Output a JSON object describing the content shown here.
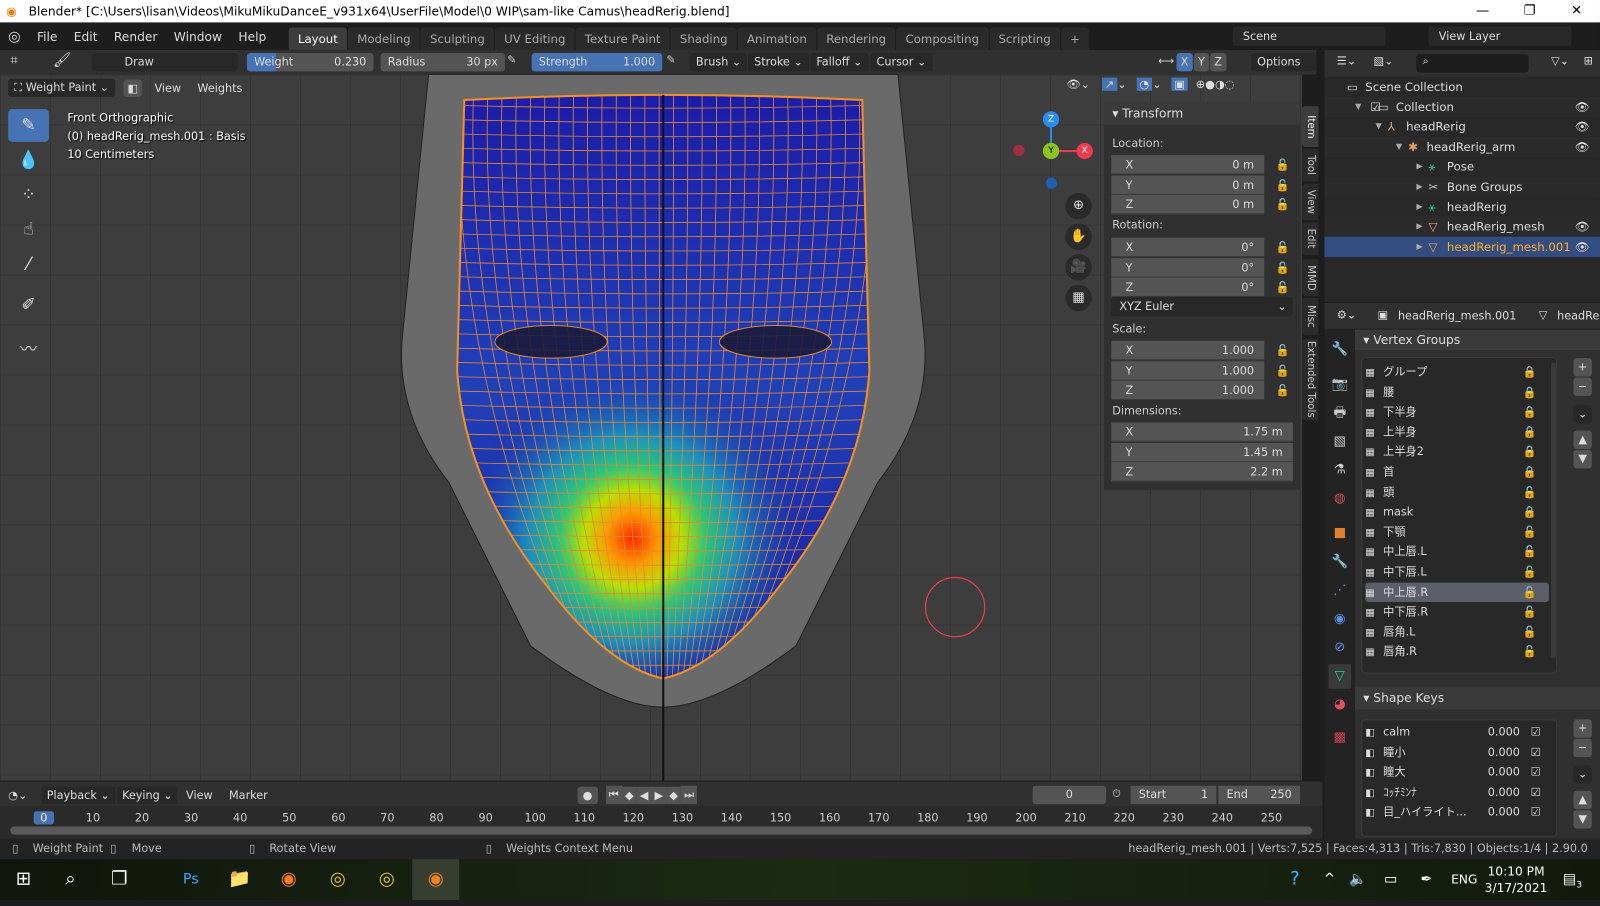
{
  "window": {
    "title": "Blender* [C:\\Users\\lisan\\Videos\\MikuMikuDanceE_v931x64\\UserFile\\Model\\0 WIP\\sam-like Camus\\headRerig.blend]",
    "minimize": "—",
    "maximize": "❐",
    "close": "✕"
  },
  "menu": [
    "File",
    "Edit",
    "Render",
    "Window",
    "Help"
  ],
  "workspaces": [
    "Layout",
    "Modeling",
    "Sculpting",
    "UV Editing",
    "Texture Paint",
    "Shading",
    "Animation",
    "Rendering",
    "Compositing",
    "Scripting",
    "+"
  ],
  "scene": {
    "name": "Scene",
    "view_layer": "View Layer"
  },
  "toolheader": {
    "brush": "Draw",
    "weight_label": "Weight",
    "weight": "0.230",
    "weight_value": 0.23,
    "radius_label": "Radius",
    "radius": "30 px",
    "strength_label": "Strength",
    "strength": "1.000",
    "strength_value": 1.0,
    "menus": [
      "Brush",
      "Stroke",
      "Falloff",
      "Cursor"
    ],
    "mirror": [
      "X",
      "Y",
      "Z"
    ],
    "options": "Options"
  },
  "viewport": {
    "mode": "Weight Paint",
    "menus": [
      "View",
      "Weights"
    ],
    "info": [
      "Front Orthographic",
      "(0) headRerig_mesh.001 : Basis",
      "10 Centimeters"
    ],
    "gizmo": {
      "z": "Z",
      "y": "Y",
      "x": "X"
    }
  },
  "npanel": {
    "title": "Transform",
    "location_label": "Location:",
    "rotation_label": "Rotation:",
    "scale_label": "Scale:",
    "dimensions_label": "Dimensions:",
    "axes": [
      "X",
      "Y",
      "Z"
    ],
    "location": [
      "0 m",
      "0 m",
      "0 m"
    ],
    "rotation": [
      "0°",
      "0°",
      "0°"
    ],
    "rotation_mode": "XYZ Euler",
    "scale": [
      "1.000",
      "1.000",
      "1.000"
    ],
    "dimensions": [
      "1.75 m",
      "1.45 m",
      "2.2 m"
    ],
    "tabs": [
      "Item",
      "Tool",
      "View",
      "Edit",
      "MMD",
      "Misc",
      "Extended Tools"
    ]
  },
  "outliner": {
    "items": [
      {
        "label": "Scene Collection",
        "icon": "collection-icon"
      },
      {
        "label": "Collection",
        "icon": "collection-icon"
      },
      {
        "label": "headRerig",
        "icon": "armature-icon"
      },
      {
        "label": "headRerig_arm",
        "icon": "armature-data-icon"
      },
      {
        "label": "Pose",
        "icon": "pose-icon"
      },
      {
        "label": "Bone Groups",
        "icon": "bone-icon"
      },
      {
        "label": "headRerig",
        "icon": "pose-icon"
      },
      {
        "label": "headRerig_mesh",
        "icon": "mesh-icon"
      },
      {
        "label": "headRerig_mesh.001",
        "icon": "mesh-icon",
        "selected": true
      }
    ]
  },
  "properties": {
    "object": "headRerig_mesh.001",
    "data": "headRe",
    "vertex_groups_title": "Vertex Groups",
    "vertex_groups": [
      {
        "name": "グループ",
        "locked": true
      },
      {
        "name": "腰",
        "locked": true
      },
      {
        "name": "下半身",
        "locked": true
      },
      {
        "name": "上半身",
        "locked": true
      },
      {
        "name": "上半身2",
        "locked": true
      },
      {
        "name": "首",
        "locked": true
      },
      {
        "name": "頭",
        "locked": false
      },
      {
        "name": "mask",
        "locked": true
      },
      {
        "name": "下顎",
        "locked": false
      },
      {
        "name": "中上唇.L",
        "locked": false
      },
      {
        "name": "中下唇.L",
        "locked": false
      },
      {
        "name": "中上唇.R",
        "locked": false,
        "active": true
      },
      {
        "name": "中下唇.R",
        "locked": false
      },
      {
        "name": "唇角.L",
        "locked": false
      },
      {
        "name": "唇角.R",
        "locked": false
      }
    ],
    "shape_keys_title": "Shape Keys",
    "shape_keys": [
      {
        "name": "calm",
        "value": "0.000"
      },
      {
        "name": "瞳小",
        "value": "0.000"
      },
      {
        "name": "瞳大",
        "value": "0.000"
      },
      {
        "name": "ｺｯﾁﾐﾝﾅ",
        "value": "0.000"
      },
      {
        "name": "目_ハイライト...",
        "value": "0.000"
      }
    ]
  },
  "timeline": {
    "menus": [
      "Playback",
      "Keying",
      "View",
      "Marker"
    ],
    "current_frame": "0",
    "start_label": "Start",
    "start": "1",
    "end_label": "End",
    "end": "250",
    "ticks": [
      "0",
      "10",
      "20",
      "30",
      "40",
      "50",
      "60",
      "70",
      "80",
      "90",
      "100",
      "110",
      "120",
      "130",
      "140",
      "150",
      "160",
      "170",
      "180",
      "190",
      "200",
      "210",
      "220",
      "230",
      "240",
      "250"
    ]
  },
  "status": {
    "hints": [
      "Weight Paint",
      "Move",
      "Rotate View",
      "Weights Context Menu"
    ],
    "stats": "headRerig_mesh.001 | Verts:7,525 | Faces:4,313 | Tris:7,830 | Objects:1/4 | 2.90.0"
  },
  "taskbar": {
    "time": "10:10 PM",
    "date": "3/17/2021",
    "lang": "ENG",
    "notifications": "3"
  },
  "colors": {
    "accent": "#4772b3",
    "selected_text": "#ffaf29",
    "viewport_bg": "#3d3d3d"
  }
}
